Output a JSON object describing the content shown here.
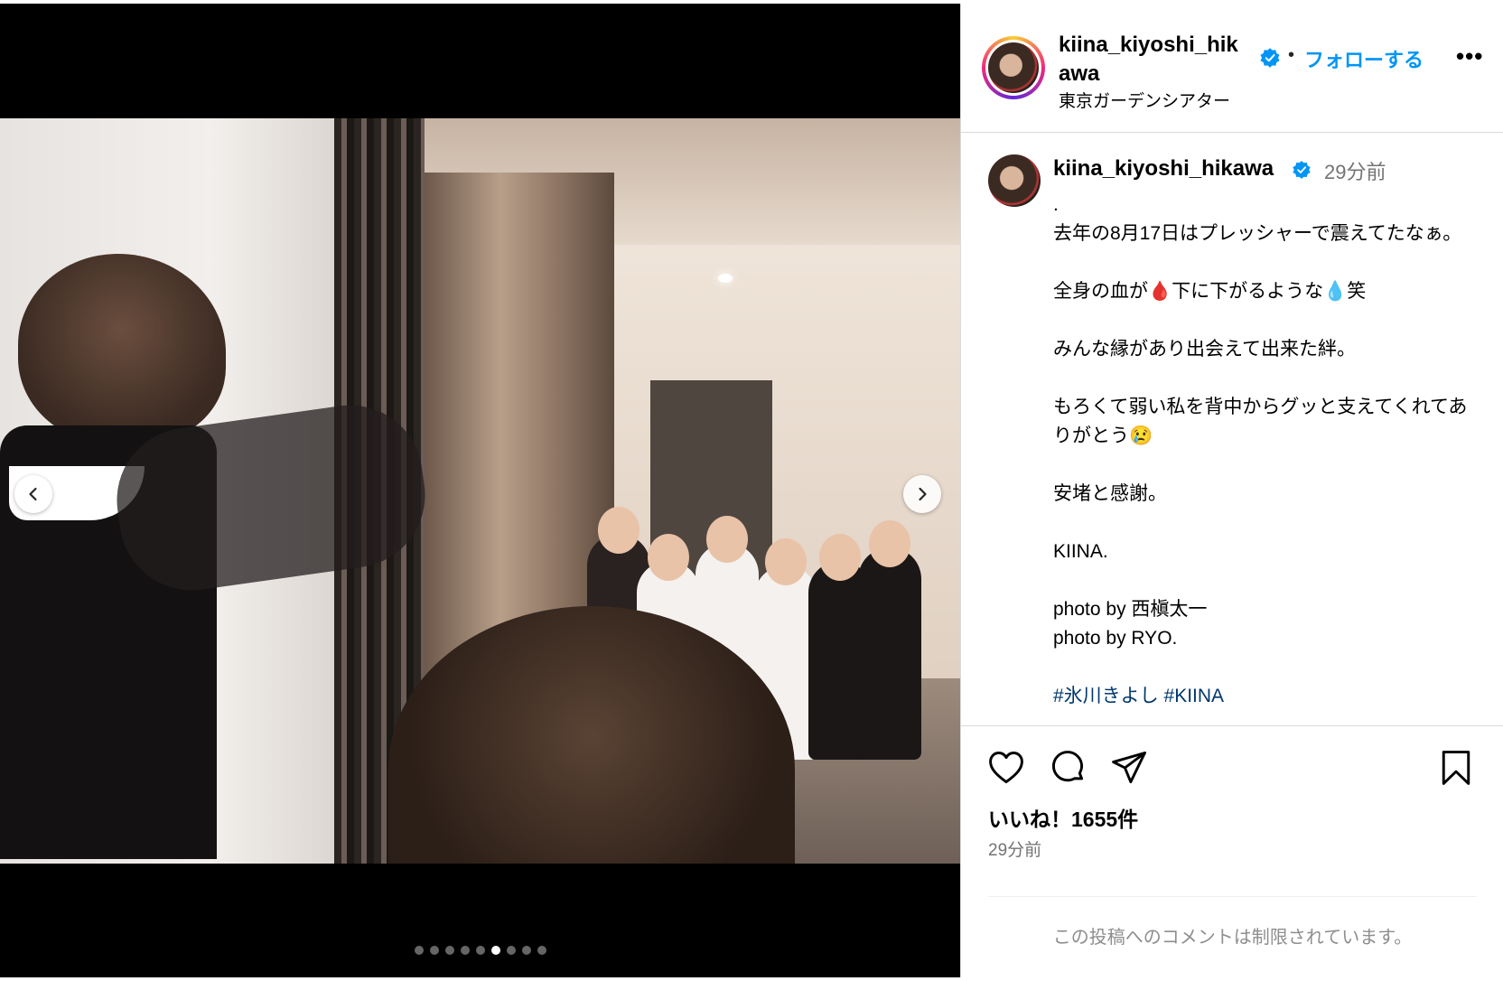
{
  "post": {
    "username_header": "kiina_kiyoshi_hikawa",
    "follow_label": "フォローする",
    "separator": "•",
    "more_label": "•••",
    "location": "東京ガーデンシアター"
  },
  "caption": {
    "username": "kiina_kiyoshi_hikawa",
    "time": "29分前",
    "lines": [
      ".",
      "去年の8月17日はプレッシャーで震えてたなぁ。",
      "",
      "全身の血が🩸下に下がるような💧笑",
      "",
      "みんな縁があり出会えて出来た絆。",
      "",
      "もろくて弱い私を背中からグッと支えてくれてありがとう😢",
      "",
      "安堵と感謝。",
      "",
      "KIINA.",
      "",
      "photo by 西槇太一",
      "photo by RYO.",
      "",
      "#氷川きよし #KIINA"
    ]
  },
  "engagement": {
    "likes": "いいね！1655件",
    "time": "29分前",
    "comments_restricted": "この投稿へのコメントは制限されています。"
  },
  "carousel": {
    "prev_icon": "‹",
    "next_icon": "›",
    "total_slides": 9,
    "active_index": 5
  },
  "colors": {
    "accent": "#0095f6",
    "verified": "#0095f6",
    "muted": "#737373",
    "border": "#dbdbdb"
  },
  "icons": {
    "like": "heart-icon",
    "comment": "comment-icon",
    "share": "share-icon",
    "save": "bookmark-icon"
  }
}
